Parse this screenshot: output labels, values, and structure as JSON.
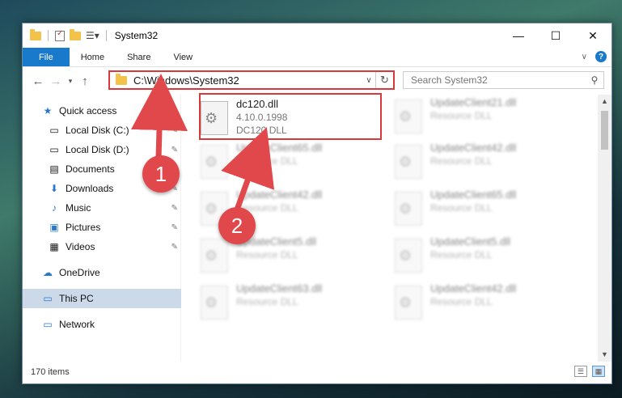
{
  "window": {
    "title": "System32",
    "controls": {
      "minimize": "—",
      "maximize": "☐",
      "close": "✕"
    }
  },
  "ribbon": {
    "tabs": [
      "File",
      "Home",
      "Share",
      "View"
    ]
  },
  "nav": {
    "address": "C:\\Windows\\System32",
    "search_placeholder": "Search System32"
  },
  "sidebar": {
    "items": [
      {
        "label": "Quick access",
        "icon": "star-icon",
        "pinned": false
      },
      {
        "label": "Local Disk (C:)",
        "icon": "drive-icon",
        "pinned": true
      },
      {
        "label": "Local Disk (D:)",
        "icon": "drive-icon",
        "pinned": true
      },
      {
        "label": "Documents",
        "icon": "documents-icon",
        "pinned": true
      },
      {
        "label": "Downloads",
        "icon": "downloads-icon",
        "pinned": true
      },
      {
        "label": "Music",
        "icon": "music-icon",
        "pinned": true
      },
      {
        "label": "Pictures",
        "icon": "pictures-icon",
        "pinned": true
      },
      {
        "label": "Videos",
        "icon": "videos-icon",
        "pinned": true
      },
      {
        "label": "OneDrive",
        "icon": "onedrive-icon",
        "pinned": false
      },
      {
        "label": "This PC",
        "icon": "this-pc-icon",
        "pinned": false,
        "selected": true
      },
      {
        "label": "Network",
        "icon": "network-icon",
        "pinned": false
      }
    ]
  },
  "files": {
    "highlighted": {
      "name": "dc120.dll",
      "version": "4.10.0.1998",
      "description": "DC120 DLL"
    },
    "col1": [
      {
        "name": "UpdateClient65.dll",
        "type": "Resource DLL"
      },
      {
        "name": "UpdateClient42.dll",
        "type": "Resource DLL"
      },
      {
        "name": "UpdateClient5.dll",
        "type": "Resource DLL"
      },
      {
        "name": "UpdateClient63.dll",
        "type": "Resource DLL"
      }
    ],
    "col2": [
      {
        "name": "UpdateClient21.dll",
        "type": "Resource DLL"
      },
      {
        "name": "UpdateClient42.dll",
        "type": "Resource DLL"
      },
      {
        "name": "UpdateClient65.dll",
        "type": "Resource DLL"
      },
      {
        "name": "UpdateClient5.dll",
        "type": "Resource DLL"
      },
      {
        "name": "UpdateClient42.dll",
        "type": "Resource DLL"
      }
    ]
  },
  "status": {
    "item_count": "170 items"
  },
  "annotations": {
    "badge1": "1",
    "badge2": "2",
    "color": "#e0484b"
  }
}
